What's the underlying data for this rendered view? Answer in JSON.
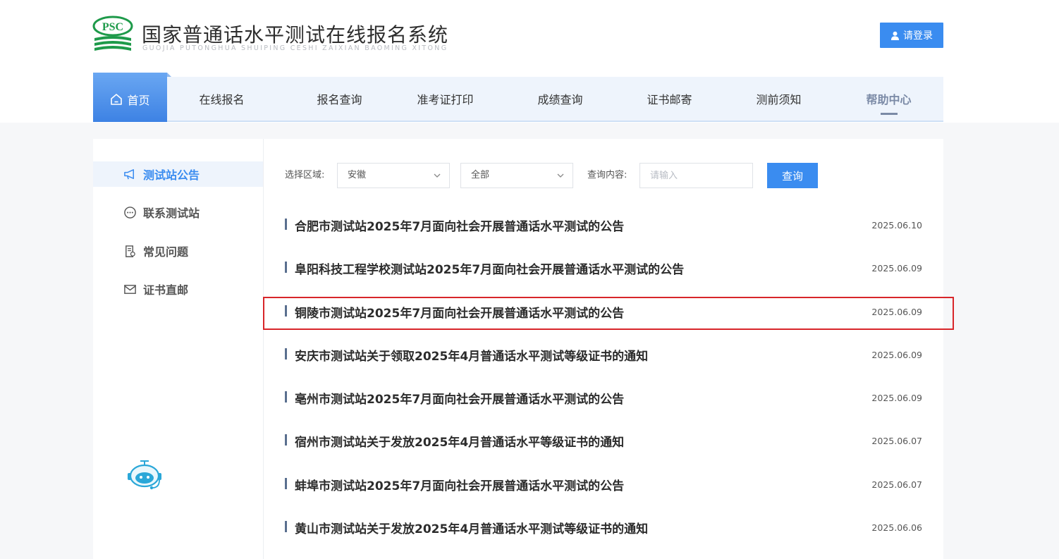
{
  "header": {
    "logo_text": "PSC",
    "title": "国家普通话水平测试在线报名系统",
    "subtitle": "GUOJIA PUTONGHUA SHUIPING CESHI ZAIXIAN BAOMING XITONG",
    "login_label": "请登录",
    "brand_color": "#1e9a4a",
    "accent_color": "#3a8cf0"
  },
  "nav": {
    "items": [
      {
        "label": "首页",
        "icon": "home-icon"
      },
      {
        "label": "在线报名"
      },
      {
        "label": "报名查询"
      },
      {
        "label": "准考证打印"
      },
      {
        "label": "成绩查询"
      },
      {
        "label": "证书邮寄"
      },
      {
        "label": "测前须知"
      },
      {
        "label": "帮助中心"
      }
    ]
  },
  "sidebar": {
    "items": [
      {
        "label": "测试站公告",
        "icon": "megaphone-icon"
      },
      {
        "label": "联系测试站",
        "icon": "chat-icon"
      },
      {
        "label": "常见问题",
        "icon": "document-icon"
      },
      {
        "label": "证书直邮",
        "icon": "mail-icon"
      }
    ],
    "assistant_icon": "robot-assistant-icon"
  },
  "filters": {
    "region_label": "选择区域:",
    "region_value": "安徽",
    "sub_value": "全部",
    "query_label": "查询内容:",
    "query_placeholder": "请输入",
    "query_button": "查询"
  },
  "announcements": [
    {
      "title": "合肥市测试站2025年7月面向社会开展普通话水平测试的公告",
      "date": "2025.06.10"
    },
    {
      "title": "阜阳科技工程学校测试站2025年7月面向社会开展普通话水平测试的公告",
      "date": "2025.06.09"
    },
    {
      "title": "铜陵市测试站2025年7月面向社会开展普通话水平测试的公告",
      "date": "2025.06.09"
    },
    {
      "title": "安庆市测试站关于领取2025年4月普通话水平测试等级证书的通知",
      "date": "2025.06.09"
    },
    {
      "title": "亳州市测试站2025年7月面向社会开展普通话水平测试的公告",
      "date": "2025.06.09"
    },
    {
      "title": "宿州市测试站关于发放2025年4月普通话水平等级证书的通知",
      "date": "2025.06.07"
    },
    {
      "title": "蚌埠市测试站2025年7月面向社会开展普通话水平测试的公告",
      "date": "2025.06.07"
    },
    {
      "title": "黄山市测试站关于发放2025年4月普通话水平测试等级证书的通知",
      "date": "2025.06.06"
    }
  ]
}
